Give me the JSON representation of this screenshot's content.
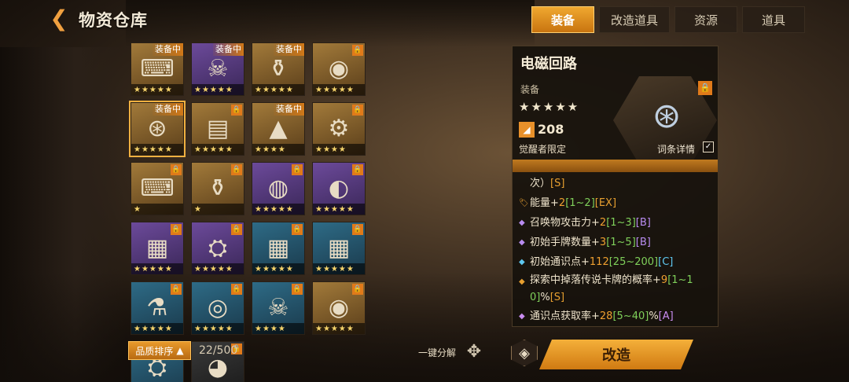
{
  "header": {
    "title": "物资仓库",
    "back_icon": "chevron-left-icon"
  },
  "tabs": [
    {
      "label": "装备",
      "active": true
    },
    {
      "label": "改造道具",
      "active": false
    },
    {
      "label": "资源",
      "active": false
    },
    {
      "label": "道具",
      "active": false
    }
  ],
  "grid": {
    "items": [
      {
        "name": "terminal",
        "icon": "⌨",
        "stars": "★★★★★",
        "badge": "装备中",
        "locked": false,
        "style": "gold"
      },
      {
        "name": "demon-mask",
        "icon": "☠",
        "stars": "★★★★★",
        "badge": "装备中",
        "locked": false,
        "style": "rare"
      },
      {
        "name": "missiles",
        "icon": "⚱",
        "stars": "★★★★★",
        "badge": "装备中",
        "locked": false,
        "style": "gold"
      },
      {
        "name": "orb-device",
        "icon": "◉",
        "stars": "★★★★★",
        "badge": "",
        "locked": true,
        "style": "gold"
      },
      {
        "name": "em-circuit",
        "icon": "⊛",
        "stars": "★★★★★",
        "badge": "装备中",
        "locked": false,
        "style": "gold",
        "selected": true
      },
      {
        "name": "battery-pack",
        "icon": "▤",
        "stars": "★★★★★",
        "badge": "",
        "locked": true,
        "style": "gold"
      },
      {
        "name": "triangle-core",
        "icon": "▲",
        "stars": "★★★★",
        "badge": "装备中",
        "locked": false,
        "style": "gold"
      },
      {
        "name": "gear-shield",
        "icon": "⚙",
        "stars": "★★★★",
        "badge": "",
        "locked": true,
        "style": "gold"
      },
      {
        "name": "terminal-2",
        "icon": "⌨",
        "stars": "★",
        "badge": "",
        "locked": true,
        "style": "gold"
      },
      {
        "name": "missiles-2",
        "icon": "⚱",
        "stars": "★",
        "badge": "",
        "locked": true,
        "style": "gold"
      },
      {
        "name": "bot-drone",
        "icon": "◍",
        "stars": "★★★★★",
        "badge": "",
        "locked": true,
        "style": "rare"
      },
      {
        "name": "lamp-device",
        "icon": "◐",
        "stars": "★★★★★",
        "badge": "",
        "locked": true,
        "style": "rare"
      },
      {
        "name": "scanner-pad",
        "icon": "▦",
        "stars": "★★★★★",
        "badge": "",
        "locked": true,
        "style": "rare"
      },
      {
        "name": "hover-sled",
        "icon": "⛭",
        "stars": "★★★★★",
        "badge": "",
        "locked": true,
        "style": "rare"
      },
      {
        "name": "scanner-pad-2",
        "icon": "▦",
        "stars": "★★★★★",
        "badge": "",
        "locked": true,
        "style": "blue"
      },
      {
        "name": "scanner-pad-3",
        "icon": "▦",
        "stars": "★★★★★",
        "badge": "",
        "locked": true,
        "style": "blue"
      },
      {
        "name": "flask",
        "icon": "⚗",
        "stars": "★★★★★",
        "badge": "",
        "locked": true,
        "style": "blue"
      },
      {
        "name": "red-coil",
        "icon": "◎",
        "stars": "★★★★★",
        "badge": "",
        "locked": true,
        "style": "blue"
      },
      {
        "name": "demon-mask-2",
        "icon": "☠",
        "stars": "★★★★",
        "badge": "",
        "locked": true,
        "style": "blue"
      },
      {
        "name": "orb-device-2",
        "icon": "◉",
        "stars": "★★★★★",
        "badge": "",
        "locked": true,
        "style": "gold"
      },
      {
        "name": "hover-sled-2",
        "icon": "⛭",
        "stars": "★★★★★",
        "badge": "",
        "locked": true,
        "style": "blue"
      },
      {
        "name": "eye-robot",
        "icon": "◕",
        "stars": "★★★★★",
        "badge": "",
        "locked": true,
        "style": "dark"
      }
    ]
  },
  "bottom": {
    "sort_label": "品质排序",
    "count": "22/500",
    "dismantle_label": "一键分解",
    "modify_label": "改造"
  },
  "detail": {
    "name": "电磁回路",
    "type": "装备",
    "stars": "★★★★★",
    "power": "208",
    "awaken": "觉醒者限定",
    "detail_link": "词条详情",
    "partial_line": {
      "text": "次）",
      "tier": "[S]"
    },
    "affixes": [
      {
        "label": "能量+",
        "val": "2",
        "rng": "[1~2]",
        "tier": "[EX]",
        "tier_class": "tier-ex",
        "dot": "🏷",
        "dot_color": "#e8a030"
      },
      {
        "label": "召唤物攻击力+",
        "val": "2",
        "rng": "[1~3]",
        "tier": "[B]",
        "tier_class": "tier-b",
        "dot": "◆",
        "dot_color": "#b88cf0"
      },
      {
        "label": "初始手牌数量+",
        "val": "3",
        "rng": "[1~5]",
        "tier": "[B]",
        "tier_class": "tier-b",
        "dot": "◆",
        "dot_color": "#b88cf0"
      },
      {
        "label": "初始通识点+",
        "val": "112",
        "rng": "[25~200]",
        "tier": "[C]",
        "tier_class": "tier-c",
        "dot": "◆",
        "dot_color": "#5ec8f0"
      },
      {
        "label": "探索中掉落传说卡牌的概率+",
        "val": "9",
        "rng_a": "[1~1",
        "rng_b": "0]",
        "suffix": "%",
        "tier": "[S]",
        "tier_class": "tier-s",
        "dot": "◆",
        "dot_color": "#e8a030",
        "wrap": true
      },
      {
        "label": "通识点获取率+",
        "val": "28",
        "rng": "[5~40]",
        "suffix": "%",
        "tier": "[A]",
        "tier_class": "tier-a",
        "dot": "◆",
        "dot_color": "#c88cf0"
      }
    ]
  }
}
